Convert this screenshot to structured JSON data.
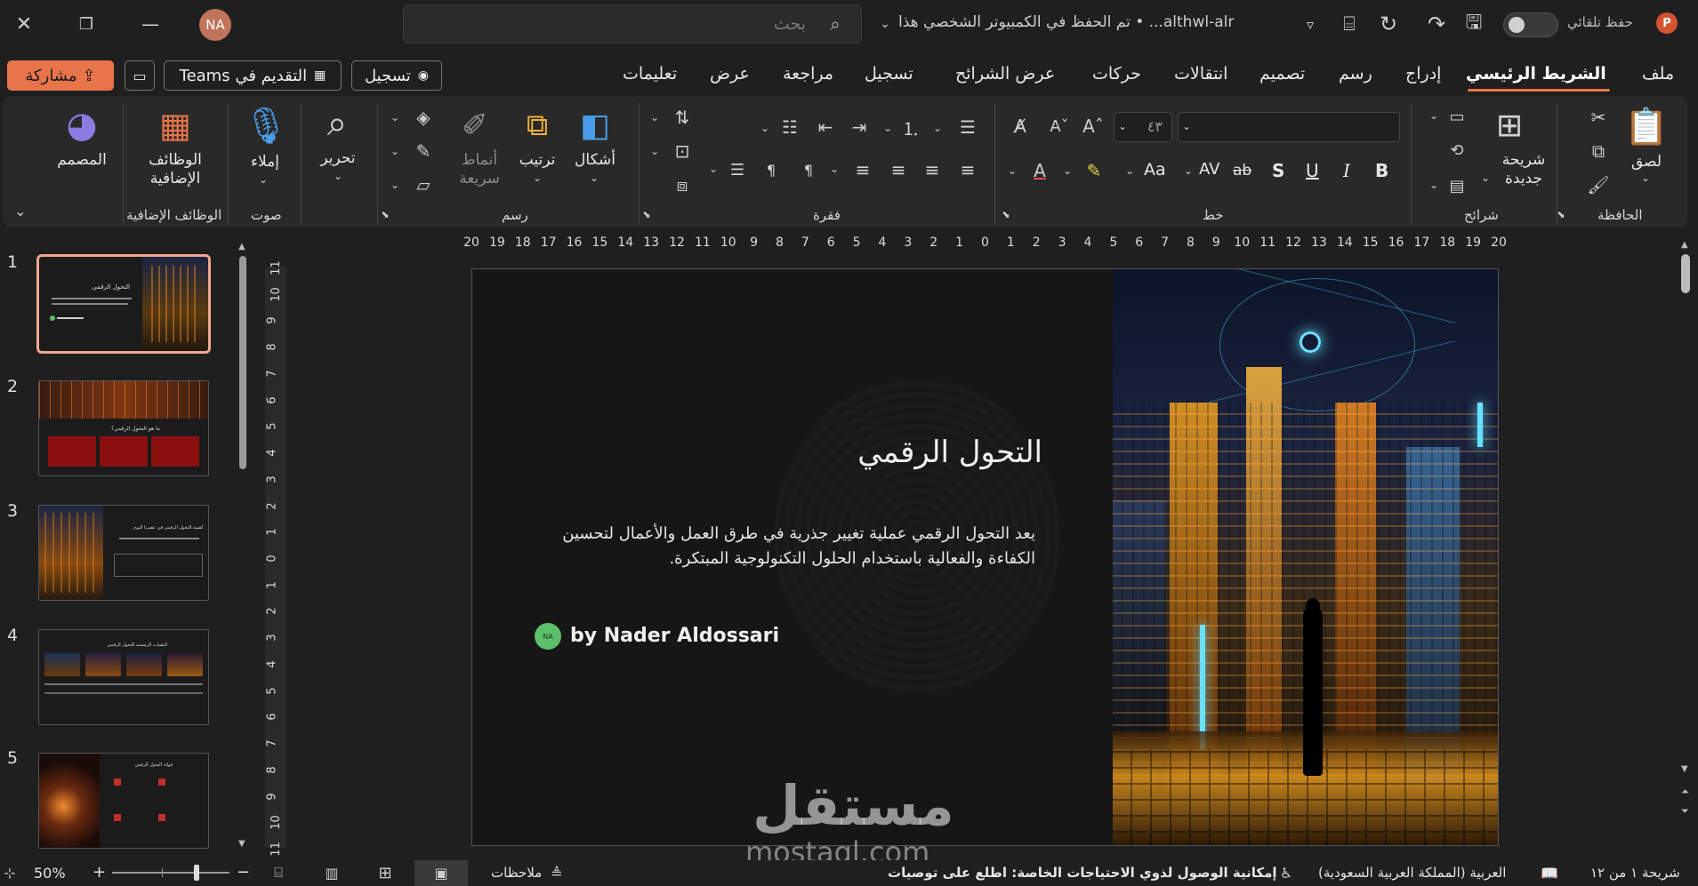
{
  "titlebar": {
    "autosave_label": "حفظ تلقائي",
    "file_name": "althwl-alr... • تم الحفظ في الكمبيوتر الشخصي هذا",
    "search_placeholder": "بحث",
    "avatar_initials": "NA",
    "app_icon_letter": "P"
  },
  "actions": {
    "share_label": "مشاركة",
    "present_teams_label": "التقديم في Teams",
    "record_label": "تسجيل"
  },
  "tabs": [
    "ملف",
    "الشريط الرئيسي",
    "إدراج",
    "رسم",
    "تصميم",
    "انتقالات",
    "حركات",
    "عرض الشرائح",
    "تسجيل",
    "مراجعة",
    "عرض",
    "تعليمات"
  ],
  "active_tab": "الشريط الرئيسي",
  "ribbon": {
    "clipboard": {
      "group": "الحافظة",
      "paste": "لصق"
    },
    "slides": {
      "group": "شرائح",
      "new_slide": "شريحة جديدة"
    },
    "font": {
      "group": "خط",
      "font_name": "",
      "font_size": "٤٣",
      "aa": "Aa",
      "bold": "B",
      "italic": "I",
      "underline": "U",
      "shadow": "S",
      "strike": "ab",
      "spacing": "AV"
    },
    "paragraph": {
      "group": "فقرة"
    },
    "drawing": {
      "group": "رسم",
      "shapes": "أشكال",
      "arrange": "ترتيب",
      "quick_styles": "أنماط سريعة"
    },
    "editing": {
      "label": "تحرير"
    },
    "voice": {
      "group": "صوت",
      "dictate": "إملاء"
    },
    "addins": {
      "group": "الوظائف الإضافية",
      "addins": "الوظائف الإضافية"
    },
    "designer": {
      "label": "المصمم"
    }
  },
  "thumbnails": [
    {
      "num": "1",
      "title": "التحول الرقمي"
    },
    {
      "num": "2",
      "title": "ما هو التحول الرقمي؟"
    },
    {
      "num": "3",
      "title": "أهمية التحول الرقمي في عصرنا اليوم"
    },
    {
      "num": "4",
      "title": "التقنيات الرئيسية للتحول الرقمي"
    },
    {
      "num": "5",
      "title": "فوائد التحول الرقمي"
    }
  ],
  "ruler": {
    "horizontal": [
      "20",
      "19",
      "18",
      "17",
      "16",
      "15",
      "14",
      "13",
      "12",
      "11",
      "10",
      "9",
      "8",
      "7",
      "6",
      "5",
      "4",
      "3",
      "2",
      "1",
      "0",
      "1",
      "2",
      "3",
      "4",
      "5",
      "6",
      "7",
      "8",
      "9",
      "10",
      "11",
      "12",
      "13",
      "14",
      "15",
      "16",
      "17",
      "18",
      "19",
      "20"
    ],
    "vertical": [
      "11",
      "10",
      "9",
      "8",
      "7",
      "6",
      "5",
      "4",
      "3",
      "2",
      "1",
      "0",
      "1",
      "2",
      "3",
      "4",
      "5",
      "6",
      "7",
      "8",
      "9",
      "10",
      "11"
    ]
  },
  "slide": {
    "title": "التحول الرقمي",
    "body": "يعد التحول الرقمي عملية تغيير جذرية في طرق العمل والأعمال لتحسين الكفاءة والفعالية باستخدام الحلول التكنولوجية المبتكرة.",
    "author": "by Nader Aldossari",
    "author_badge": "NA"
  },
  "watermark": {
    "arabic": "مستقل",
    "latin": "mostaql.com"
  },
  "status": {
    "slide_counter": "شريحة ١ من ١٢",
    "language": "العربية (المملكة العربية السعودية)",
    "accessibility": "إمكانية الوصول لذوي الاحتياجات الخاصة: اطلع على توصيات",
    "notes": "ملاحظات",
    "zoom": "50%"
  },
  "colors": {
    "accent": "#e8744a",
    "share_bg": "#e8744a",
    "selected_thumb": "#f0a890",
    "badge_green": "#5cc06a"
  }
}
